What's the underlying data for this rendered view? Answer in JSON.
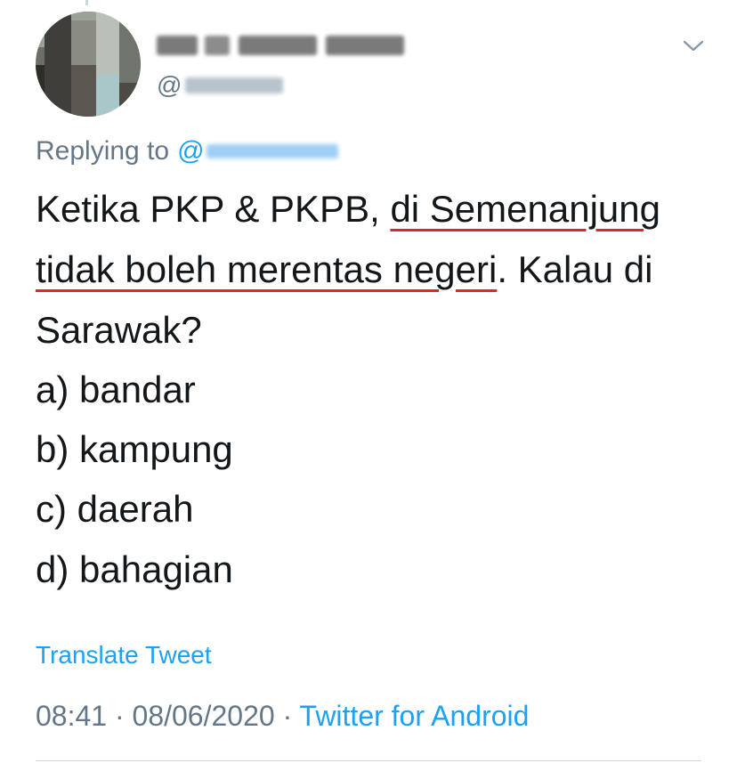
{
  "tweet": {
    "handle_prefix": "@",
    "replying_prefix": "Replying to",
    "replying_at": "@",
    "body": {
      "line1_plain": "Ketika PKP & PKPB, ",
      "line1_underlined": "di Semenanjung",
      "line2_underlined": "tidak boleh merentas negeri",
      "line2_plain": ". Kalau di",
      "line3": "Sarawak?",
      "options": [
        "a) bandar",
        "b) kampung",
        "c) daerah",
        "d) bahagian"
      ]
    },
    "translate_label": "Translate Tweet",
    "time": "08:41",
    "date": "08/06/2020",
    "source": "Twitter for Android",
    "separator": "·"
  },
  "colors": {
    "text": "#14171a",
    "secondary": "#657786",
    "link": "#1da1f2",
    "underline": "#e0242b"
  },
  "icons": {
    "menu": "chevron-down-icon"
  }
}
